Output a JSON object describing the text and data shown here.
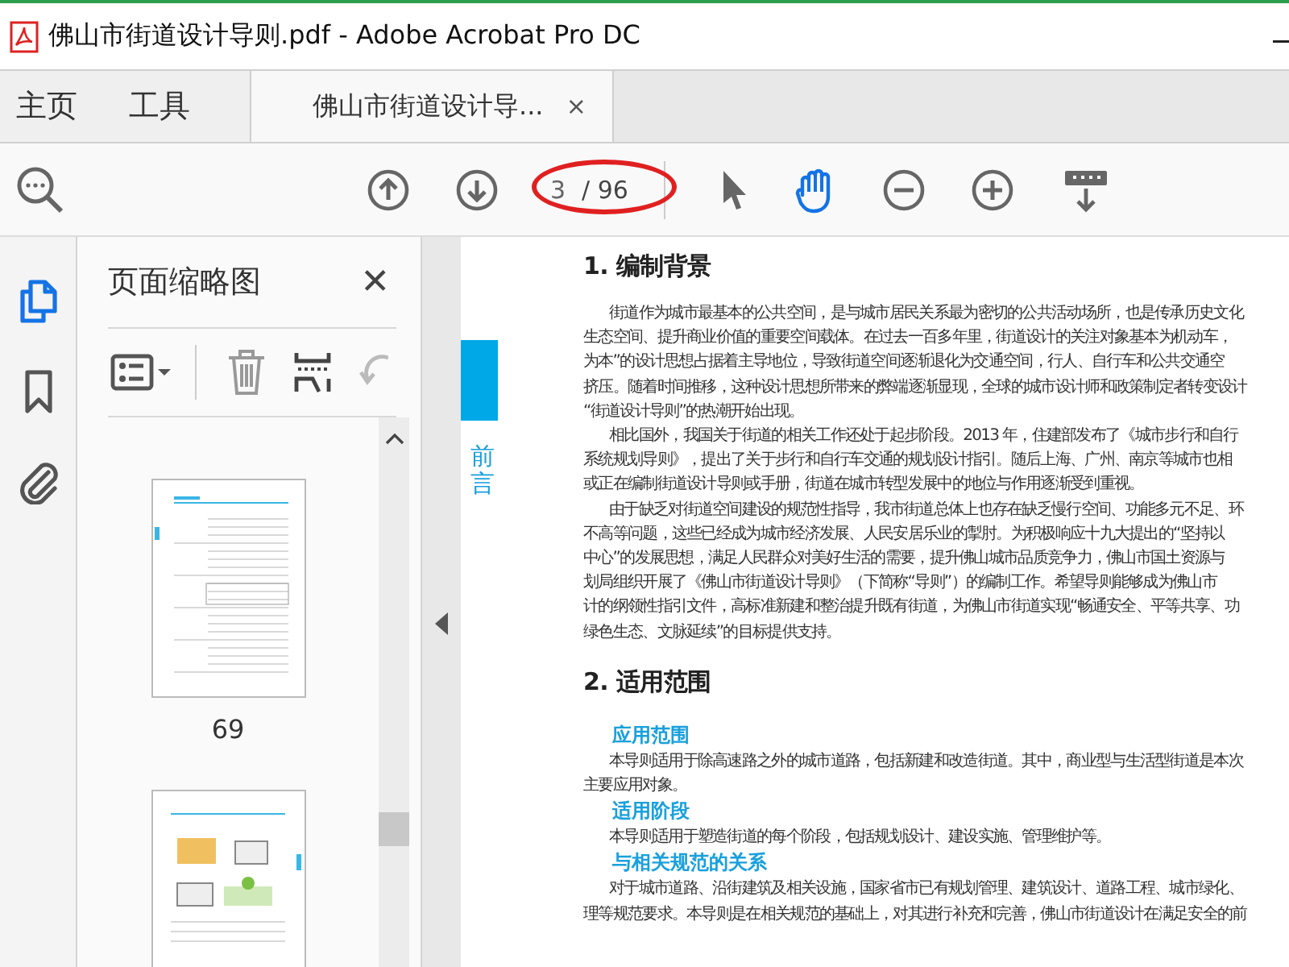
{
  "window": {
    "title": "佛山市街道设计导则.pdf - Adobe Acrobat Pro DC"
  },
  "tabs": [
    {
      "kind": "nav",
      "label": "主页",
      "selected": false
    },
    {
      "kind": "nav",
      "label": "工具",
      "selected": false
    },
    {
      "kind": "document",
      "label": "佛山市街道设计导...",
      "selected": true,
      "close": "×"
    }
  ],
  "toolbar": {
    "page_field": {
      "value": "3"
    },
    "page_total": "/ 96",
    "tools": [
      {
        "kind": "select",
        "selected": false
      },
      {
        "kind": "hand",
        "selected": true
      }
    ]
  },
  "sidebar": {
    "items": [
      {
        "kind": "pages",
        "selected": true
      },
      {
        "kind": "bookmarks",
        "selected": false
      },
      {
        "kind": "attachments",
        "selected": false
      }
    ]
  },
  "thumbnails_panel": {
    "title": "页面缩略图",
    "close": "✕",
    "thumbnails": [
      {
        "kind": "text-page",
        "label": "69"
      },
      {
        "kind": "illustrated-page"
      }
    ]
  },
  "document": {
    "side_tab": "前言",
    "sections": [
      {
        "heading": "1. 编制背景",
        "blocks": [
          {
            "kind": "paragraph",
            "lines": [
              "街道作为城市最基本的公共空间，是与城市居民关系最为密切的公共活动场所，也是传承历史文化",
              "生态空间、提升商业价值的重要空间载体。在过去一百多年里，街道设计的关注对象基本为机动车，",
              "为本”的设计思想占据着主导地位，导致街道空间逐渐退化为交通空间，行人、自行车和公共交通空",
              "挤压。随着时间推移，这种设计思想所带来的弊端逐渐显现，全球的城市设计师和政策制定者转变设计",
              "“街道设计导则”的热潮开始出现。"
            ]
          },
          {
            "kind": "paragraph",
            "lines": [
              "相比国外，我国关于街道的相关工作还处于起步阶段。2013 年，住建部发布了《城市步行和自行",
              "系统规划导则》，提出了关于步行和自行车交通的规划设计指引。随后上海、广州、南京等城市也相",
              "或正在编制街道设计导则或手册，街道在城市转型发展中的地位与作用逐渐受到重视。"
            ]
          },
          {
            "kind": "paragraph",
            "lines": [
              "由于缺乏对街道空间建设的规范性指导，我市街道总体上也存在缺乏慢行空间、功能多元不足、环",
              "不高等问题，这些已经成为城市经济发展、人民安居乐业的掣肘。为积极响应十九大提出的“坚持以",
              "中心”的发展思想，满足人民群众对美好生活的需要，提升佛山城市品质竞争力，佛山市国土资源与",
              "划局组织开展了《佛山市街道设计导则》（下简称“导则”）的编制工作。希望导则能够成为佛山市",
              "计的纲领性指引文件，高标准新建和整治提升既有街道，为佛山市街道实现“畅通安全、平等共享、功",
              "绿色生态、文脉延续”的目标提供支持。"
            ]
          }
        ]
      },
      {
        "heading": "2. 适用范围",
        "blocks": [
          {
            "kind": "subheading",
            "text": "应用范围"
          },
          {
            "kind": "paragraph",
            "lines": [
              "本导则适用于除高速路之外的城市道路，包括新建和改造街道。其中，商业型与生活型街道是本次",
              "主要应用对象。"
            ]
          },
          {
            "kind": "subheading",
            "text": "适用阶段"
          },
          {
            "kind": "paragraph",
            "lines": [
              "本导则适用于塑造街道的每个阶段，包括规划设计、建设实施、管理维护等。"
            ]
          },
          {
            "kind": "subheading",
            "text": "与相关规范的关系"
          },
          {
            "kind": "paragraph",
            "lines": [
              "对于城市道路、沿街建筑及相关设施，国家省市已有规划管理、建筑设计、道路工程、城市绿化、",
              "理等规范要求。本导则是在相关规范的基础上，对其进行补充和完善，佛山市街道设计在满足安全的前"
            ]
          }
        ]
      }
    ]
  }
}
